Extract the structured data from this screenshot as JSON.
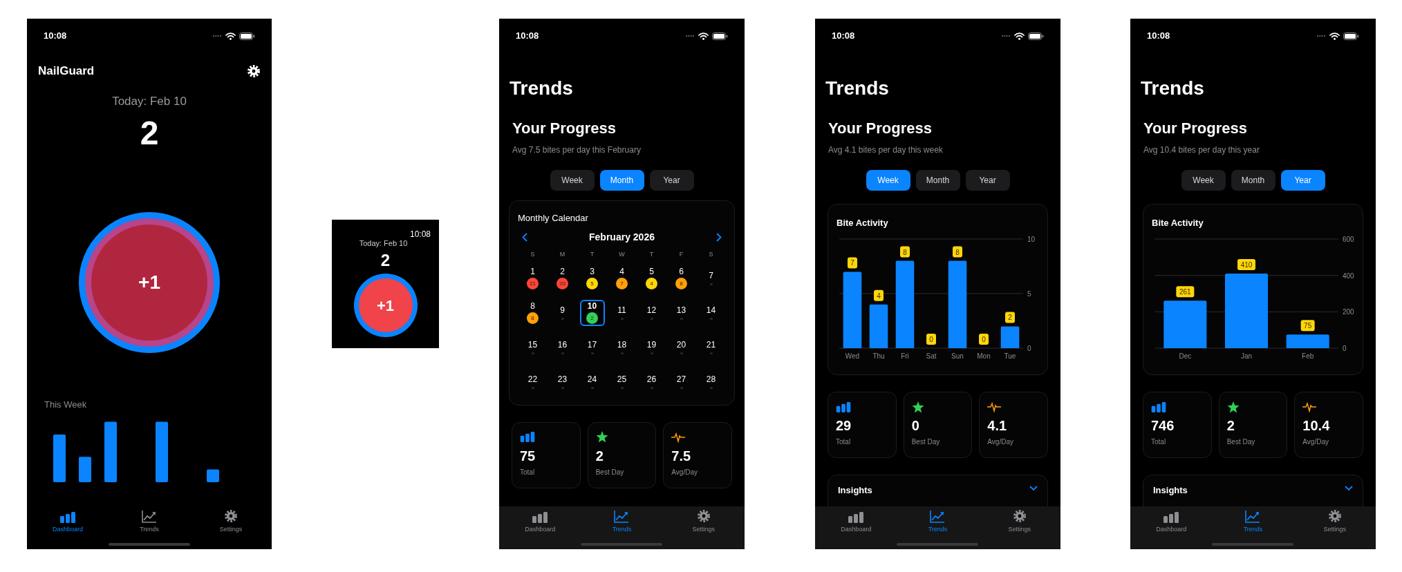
{
  "dashboard_phone": {
    "status_time": "10:08",
    "app_title": "NailGuard",
    "date": "Today: Feb 10",
    "count": "2",
    "button_label": "+1",
    "section_title": "This Week",
    "tab_bar": [
      {
        "kind": "bars",
        "label": "Dashboard",
        "selected": true
      },
      {
        "kind": "chart",
        "label": "Trends",
        "selected": false
      },
      {
        "kind": "gear",
        "label": "Settings",
        "selected": false
      }
    ]
  },
  "watch": {
    "time": "10:08",
    "date": "Today: Feb 10",
    "count": "2",
    "button_label": "+1"
  },
  "trends_screens": [
    {
      "status_time": "10:08",
      "title": "Trends",
      "heading": "Your Progress",
      "subtitle": "Avg 7.5 bites per day this February",
      "segments": [
        {
          "label": "Week",
          "selected": false
        },
        {
          "label": "Month",
          "selected": true
        },
        {
          "label": "Year",
          "selected": false
        }
      ],
      "card": {
        "kind": "calendar",
        "title": "Monthly Calendar",
        "month": "February 2026",
        "weekdays": [
          "S",
          "M",
          "T",
          "W",
          "T",
          "F",
          "S"
        ],
        "days": [
          {
            "day": "1",
            "count": "21",
            "color": "#ff453a",
            "selected": false
          },
          {
            "day": "2",
            "count": "20",
            "color": "#ff453a",
            "selected": false
          },
          {
            "day": "3",
            "count": "5",
            "color": "#ffd60a",
            "selected": false
          },
          {
            "day": "4",
            "count": "7",
            "color": "#ff9f0a",
            "selected": false
          },
          {
            "day": "5",
            "count": "4",
            "color": "#ffd60a",
            "selected": false
          },
          {
            "day": "6",
            "count": "8",
            "color": "#ff9f0a",
            "selected": false
          },
          {
            "day": "7",
            "selected": false
          },
          {
            "day": "8",
            "count": "8",
            "color": "#ff9f0a",
            "selected": false
          },
          {
            "day": "9",
            "selected": false
          },
          {
            "day": "10",
            "count": "2",
            "color": "#30d158",
            "selected": true
          },
          {
            "day": "11",
            "selected": false
          },
          {
            "day": "12",
            "selected": false
          },
          {
            "day": "13",
            "selected": false
          },
          {
            "day": "14",
            "selected": false
          },
          {
            "day": "15",
            "selected": false
          },
          {
            "day": "16",
            "selected": false
          },
          {
            "day": "17",
            "selected": false
          },
          {
            "day": "18",
            "selected": false
          },
          {
            "day": "19",
            "selected": false
          },
          {
            "day": "20",
            "selected": false
          },
          {
            "day": "21",
            "selected": false
          },
          {
            "day": "22",
            "selected": false
          },
          {
            "day": "23",
            "selected": false
          },
          {
            "day": "24",
            "selected": false
          },
          {
            "day": "25",
            "selected": false
          },
          {
            "day": "26",
            "selected": false
          },
          {
            "day": "27",
            "selected": false
          },
          {
            "day": "28",
            "selected": false
          }
        ]
      },
      "stats": [
        {
          "kind": "bars",
          "value": "75",
          "label": "Total"
        },
        {
          "kind": "star",
          "value": "2",
          "label": "Best Day"
        },
        {
          "kind": "pulse",
          "value": "7.5",
          "label": "Avg/Day"
        }
      ],
      "tab_bar": [
        {
          "kind": "bars",
          "label": "Dashboard",
          "selected": false
        },
        {
          "kind": "chart",
          "label": "Trends",
          "selected": true
        },
        {
          "kind": "gear",
          "label": "Settings",
          "selected": false
        }
      ]
    },
    {
      "status_time": "10:08",
      "title": "Trends",
      "heading": "Your Progress",
      "subtitle": "Avg 4.1 bites per day this week",
      "segments": [
        {
          "label": "Week",
          "selected": true
        },
        {
          "label": "Month",
          "selected": false
        },
        {
          "label": "Year",
          "selected": false
        }
      ],
      "card": {
        "kind": "chart",
        "title": "Bite Activity",
        "chart_data": {
          "type": "bar",
          "categories": [
            "Wed",
            "Thu",
            "Fri",
            "Sat",
            "Sun",
            "Mon",
            "Tue"
          ],
          "series": [
            {
              "color": "#0a84ff",
              "values": [
                7,
                4,
                8,
                0,
                8,
                0,
                2
              ]
            }
          ],
          "ylim": [
            0,
            10
          ],
          "yticks": [
            0,
            5,
            10
          ],
          "data_labels": true
        }
      },
      "stats": [
        {
          "kind": "bars",
          "value": "29",
          "label": "Total"
        },
        {
          "kind": "star",
          "value": "0",
          "label": "Best Day"
        },
        {
          "kind": "pulse",
          "value": "4.1",
          "label": "Avg/Day"
        }
      ],
      "insights_title": "Insights",
      "tab_bar": [
        {
          "kind": "bars",
          "label": "Dashboard",
          "selected": false
        },
        {
          "kind": "chart",
          "label": "Trends",
          "selected": true
        },
        {
          "kind": "gear",
          "label": "Settings",
          "selected": false
        }
      ]
    },
    {
      "status_time": "10:08",
      "title": "Trends",
      "heading": "Your Progress",
      "subtitle": "Avg 10.4 bites per day this year",
      "segments": [
        {
          "label": "Week",
          "selected": false
        },
        {
          "label": "Month",
          "selected": false
        },
        {
          "label": "Year",
          "selected": true
        }
      ],
      "card": {
        "kind": "chart",
        "title": "Bite Activity",
        "chart_data": {
          "type": "bar",
          "categories": [
            "Dec",
            "Jan",
            "Feb"
          ],
          "series": [
            {
              "color": "#0a84ff",
              "values": [
                261,
                410,
                75
              ]
            }
          ],
          "ylim": [
            0,
            600
          ],
          "yticks": [
            0,
            200,
            400,
            600
          ],
          "data_labels": true
        }
      },
      "stats": [
        {
          "kind": "bars",
          "value": "746",
          "label": "Total"
        },
        {
          "kind": "star",
          "value": "2",
          "label": "Best Day"
        },
        {
          "kind": "pulse",
          "value": "10.4",
          "label": "Avg/Day"
        }
      ],
      "insights_title": "Insights",
      "tab_bar": [
        {
          "kind": "bars",
          "label": "Dashboard",
          "selected": false
        },
        {
          "kind": "chart",
          "label": "Trends",
          "selected": true
        },
        {
          "kind": "gear",
          "label": "Settings",
          "selected": false
        }
      ]
    }
  ]
}
